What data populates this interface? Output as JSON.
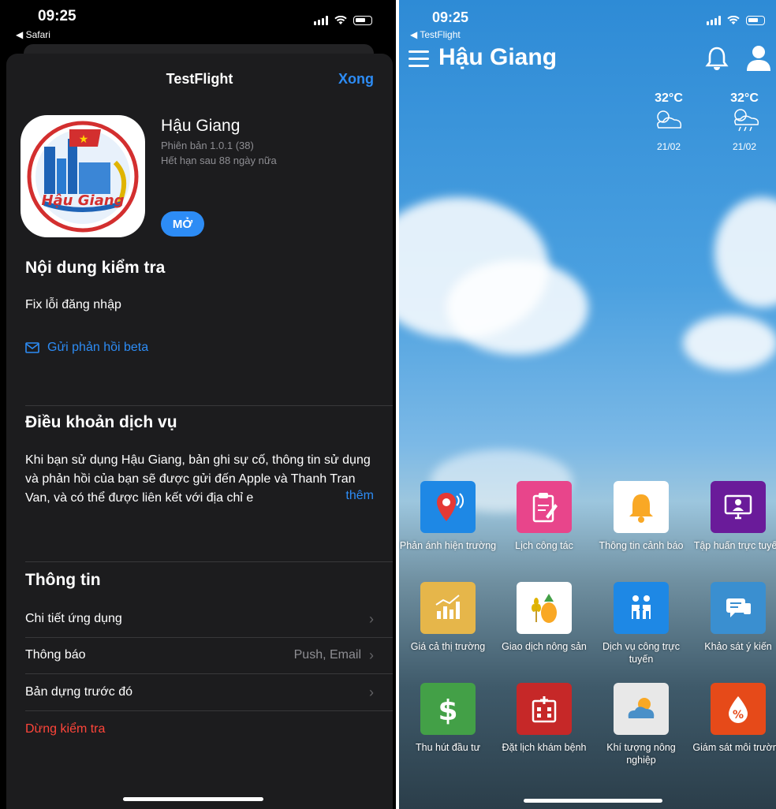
{
  "left": {
    "status": {
      "time": "09:25",
      "back_app": "◀ Safari"
    },
    "nav": {
      "title": "TestFlight",
      "done": "Xong"
    },
    "app": {
      "name": "Hậu Giang",
      "version": "Phiên bản 1.0.1 (38)",
      "expires": "Hết hạn sau 88 ngày nữa",
      "open_button": "MỞ",
      "icon_text": "Hậu Giang"
    },
    "test_content": {
      "heading": "Nội dung kiểm tra",
      "body": "Fix lỗi đăng nhập",
      "feedback_link": "Gửi phản hồi beta"
    },
    "terms": {
      "heading": "Điều khoản dịch vụ",
      "body": "Khi bạn sử dụng Hậu Giang, bản ghi sự cố, thông tin sử dụng và phản hồi của bạn sẽ được gửi đến Apple và Thanh Tran Van, và có thể được liên kết với địa chỉ e",
      "more": "thêm"
    },
    "info": {
      "heading": "Thông tin",
      "rows": [
        {
          "label": "Chi tiết ứng dụng",
          "value": ""
        },
        {
          "label": "Thông báo",
          "value": "Push, Email"
        },
        {
          "label": "Bản dựng trước đó",
          "value": ""
        }
      ],
      "stop": "Dừng kiểm tra"
    },
    "colors": {
      "accent": "#2d8cf5",
      "danger": "#ff453a",
      "sheet": "#1c1c1e"
    }
  },
  "right": {
    "status": {
      "time": "09:25",
      "back_app": "◀ TestFlight"
    },
    "header": {
      "title": "Hậu Giang",
      "icons": [
        "menu-icon",
        "bell-icon",
        "user-icon"
      ]
    },
    "weather": [
      {
        "temp": "32°C",
        "date": "21/02",
        "icon": "partly-cloudy-icon"
      },
      {
        "temp": "32°C",
        "date": "21/02",
        "icon": "sun-rain-icon"
      }
    ],
    "tiles": [
      {
        "label": "Phản ánh hiện trường",
        "icon": "location-pin-icon",
        "color": "#1e88e5"
      },
      {
        "label": "Lịch công tác",
        "icon": "clipboard-edit-icon",
        "color": "#e8458b"
      },
      {
        "label": "Thông tin cảnh báo",
        "icon": "alarm-bell-icon",
        "color": "#ffffff"
      },
      {
        "label": "Tập huấn trực tuyến",
        "icon": "monitor-user-icon",
        "color": "#6a1b9a"
      },
      {
        "label": "Giá cả thị trường",
        "icon": "chart-up-icon",
        "color": "#e6b64a"
      },
      {
        "label": "Giao dịch nông sản",
        "icon": "pineapple-rice-icon",
        "color": "#ffffff"
      },
      {
        "label": "Dịch vụ công trực tuyến",
        "icon": "handshake-icon",
        "color": "#1e88e5"
      },
      {
        "label": "Khảo sát ý kiến",
        "icon": "chat-bubble-icon",
        "color": "#3a8fd0"
      },
      {
        "label": "Thu hút đầu tư",
        "icon": "dollar-icon",
        "color": "#43a047"
      },
      {
        "label": "Đặt lịch khám bệnh",
        "icon": "hospital-icon",
        "color": "#c62828"
      },
      {
        "label": "Khí tượng nông nghiệp",
        "icon": "weather-sun-cloud-icon",
        "color": "#e8e8e8"
      },
      {
        "label": "Giám sát môi trường",
        "icon": "drop-percent-icon",
        "color": "#e64a19"
      }
    ]
  }
}
